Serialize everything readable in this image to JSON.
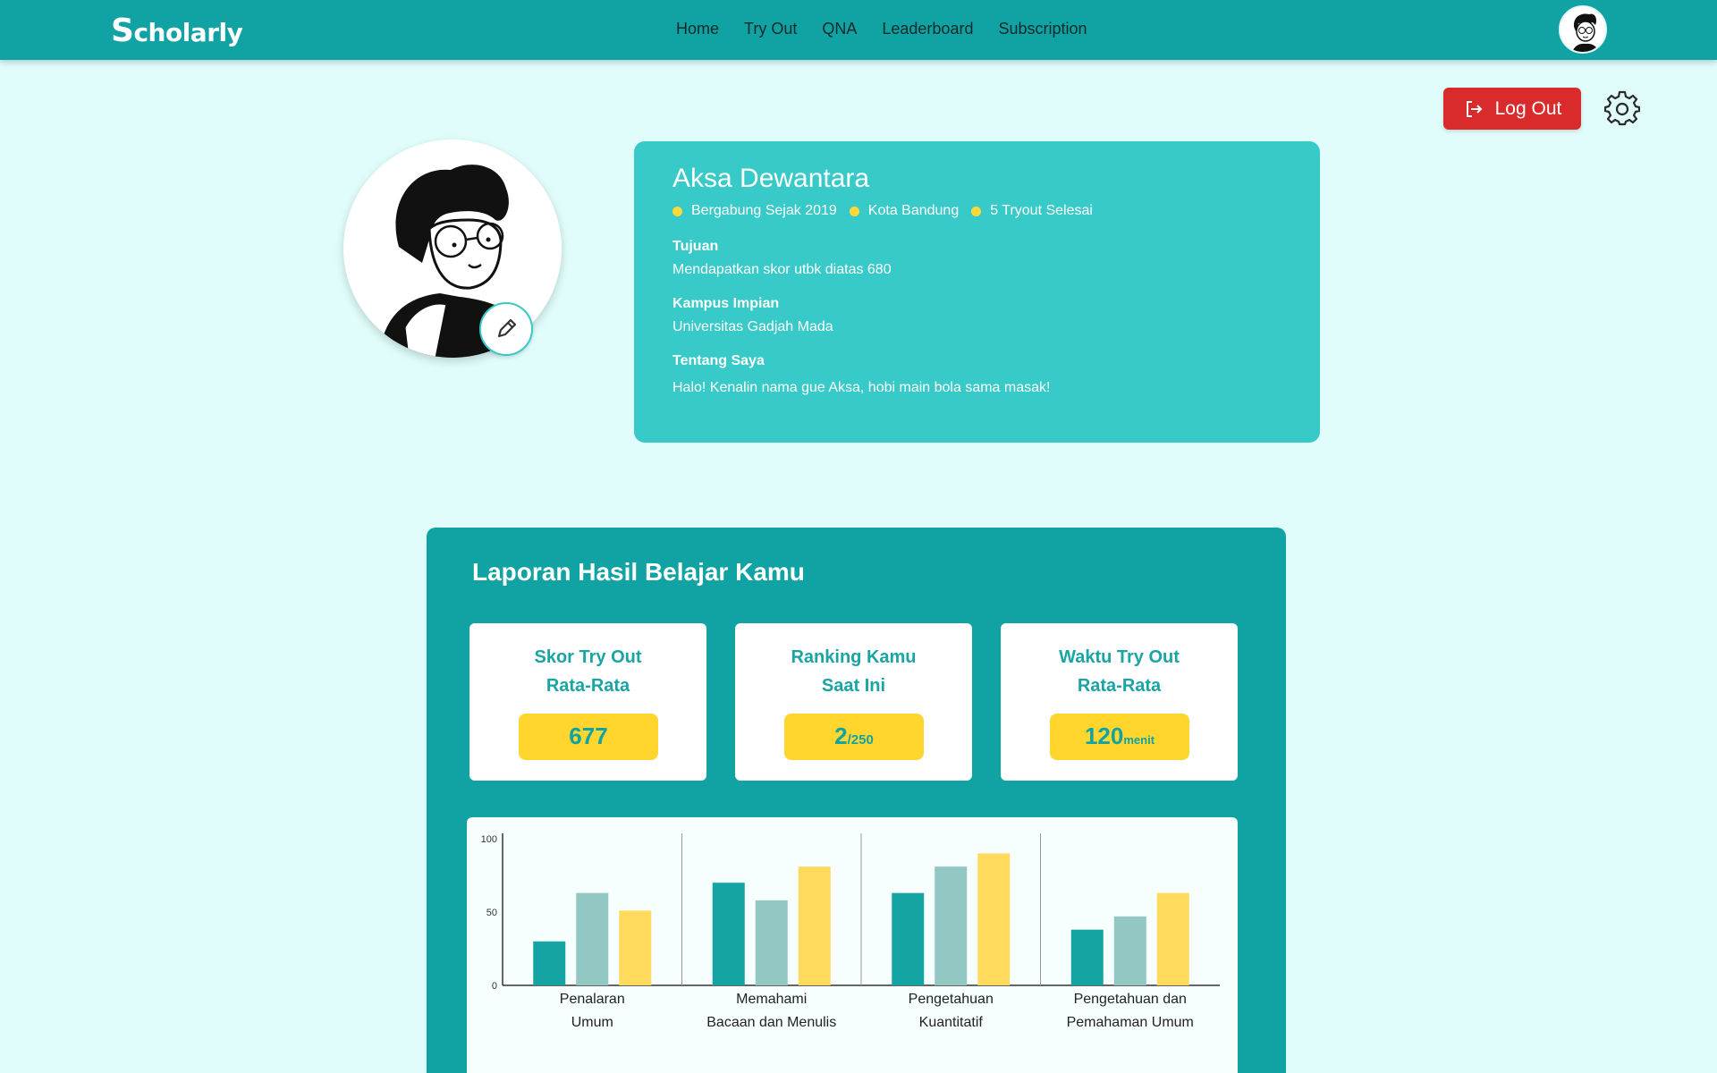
{
  "brand": {
    "logo_first": "S",
    "logo_rest": "cholarly"
  },
  "nav": {
    "links": [
      "Home",
      "Try Out",
      "QNA",
      "Leaderboard",
      "Subscription"
    ]
  },
  "actions": {
    "logout_label": "Log Out"
  },
  "profile": {
    "name": "Aksa Dewantara",
    "meta": [
      "Bergabung Sejak 2019",
      "Kota Bandung",
      "5 Tryout Selesai"
    ],
    "goal_label": "Tujuan",
    "goal_value": "Mendapatkan skor utbk diatas 680",
    "campus_label": "Kampus Impian",
    "campus_value": "Universitas Gadjah Mada",
    "about_label": "Tentang Saya",
    "about_value": "Halo! Kenalin nama gue Aksa, hobi main bola sama masak!"
  },
  "report": {
    "title": "Laporan Hasil Belajar Kamu",
    "stats": [
      {
        "title_line1": "Skor Try Out",
        "title_line2": "Rata-Rata",
        "value": "677",
        "unit": ""
      },
      {
        "title_line1": "Ranking Kamu",
        "title_line2": "Saat Ini",
        "value": "2",
        "unit": "/250"
      },
      {
        "title_line1": "Waktu Try Out",
        "title_line2": "Rata-Rata",
        "value": "120",
        "unit": "menit"
      }
    ]
  },
  "colors": {
    "navbar": "#11a3a3",
    "background": "#e0fdfb",
    "card": "#38c9c9",
    "logout": "#d92b2b",
    "accent_yellow": "#ffd52e",
    "series1": "#15a4a4",
    "series2": "#92c7c4",
    "series3": "#ffda5c"
  },
  "chart_data": {
    "type": "bar",
    "categories": [
      [
        "Penalaran",
        "Umum"
      ],
      [
        "Memahami",
        "Bacaan dan Menulis"
      ],
      [
        "Pengetahuan",
        "Kuantitatif"
      ],
      [
        "Pengetahuan dan",
        "Pemahaman Umum"
      ]
    ],
    "series": [
      {
        "values": [
          30,
          70,
          63,
          38
        ]
      },
      {
        "values": [
          63,
          58,
          81,
          47
        ]
      },
      {
        "values": [
          51,
          81,
          90,
          63
        ]
      }
    ],
    "ylim": [
      0,
      100
    ],
    "yticks": [
      "0",
      "50",
      "100"
    ],
    "grid": false,
    "legend": "bottom"
  }
}
